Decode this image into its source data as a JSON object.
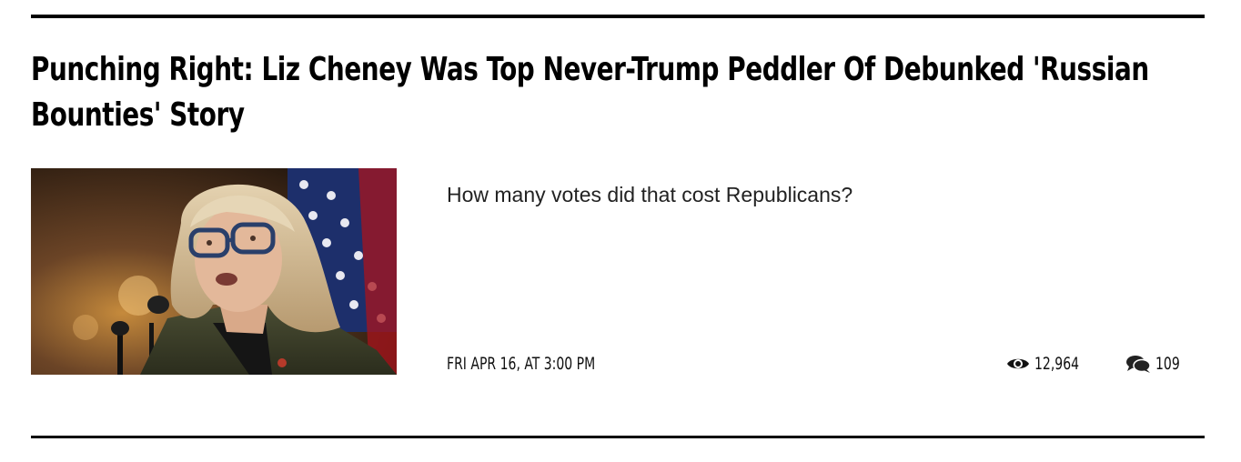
{
  "article": {
    "headline": "Punching Right: Liz Cheney Was Top Never-Trump Peddler Of Debunked 'Russian Bounties' Story",
    "teaser": "How many votes did that cost Republicans?",
    "date": "FRI APR 16, AT 3:00 PM",
    "views": "12,964",
    "comments": "109",
    "thumbnail": {
      "subject": "woman with glasses speaking at a microphone, American flag in background"
    }
  },
  "icons": {
    "views": "eye-icon",
    "comments": "comment-bubbles-icon"
  },
  "colors": {
    "text": "#111111",
    "rule": "#000000",
    "background": "#ffffff"
  }
}
